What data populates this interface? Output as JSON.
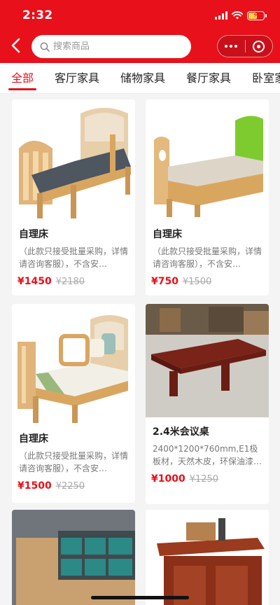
{
  "status": {
    "time": "2:32"
  },
  "search": {
    "placeholder": "搜索商品"
  },
  "tabs": [
    {
      "label": "全部",
      "active": true
    },
    {
      "label": "客厅家具",
      "active": false
    },
    {
      "label": "储物家具",
      "active": false
    },
    {
      "label": "餐厅家具",
      "active": false
    },
    {
      "label": "卧室家具",
      "active": false
    }
  ],
  "products": [
    {
      "name": "自理床",
      "desc": "（此款只接受批量采购，详情请咨询客服），不含安…",
      "price": "¥1450",
      "old_price": "¥2180",
      "image": "wooden-bed-blue-mattress"
    },
    {
      "name": "自理床",
      "desc": "（此款只接受批量采购，详情请咨询客服），不含安…",
      "price": "¥750",
      "old_price": "¥1500",
      "image": "wooden-bed-green-headboard"
    },
    {
      "name": "自理床",
      "desc": "（此款只接受批量采购，详情请咨询客服），不含安…",
      "price": "¥1500",
      "old_price": "¥2250",
      "image": "wooden-bed-side-rails"
    },
    {
      "name": "2.4米会议桌",
      "desc": "2400*1200*760mm,E1极板材，天然木皮，环保油漆…",
      "price": "¥1000",
      "old_price": "¥1250",
      "image": "conference-table"
    },
    {
      "name": "",
      "desc": "",
      "price": "",
      "old_price": "",
      "image": "bookshelf-cabinet"
    },
    {
      "name": "",
      "desc": "",
      "price": "",
      "old_price": "",
      "image": "tea-cabinet"
    }
  ],
  "colors": {
    "brand_red": "#e8101a",
    "price_red": "#e8101a",
    "text_gray": "#777777"
  }
}
